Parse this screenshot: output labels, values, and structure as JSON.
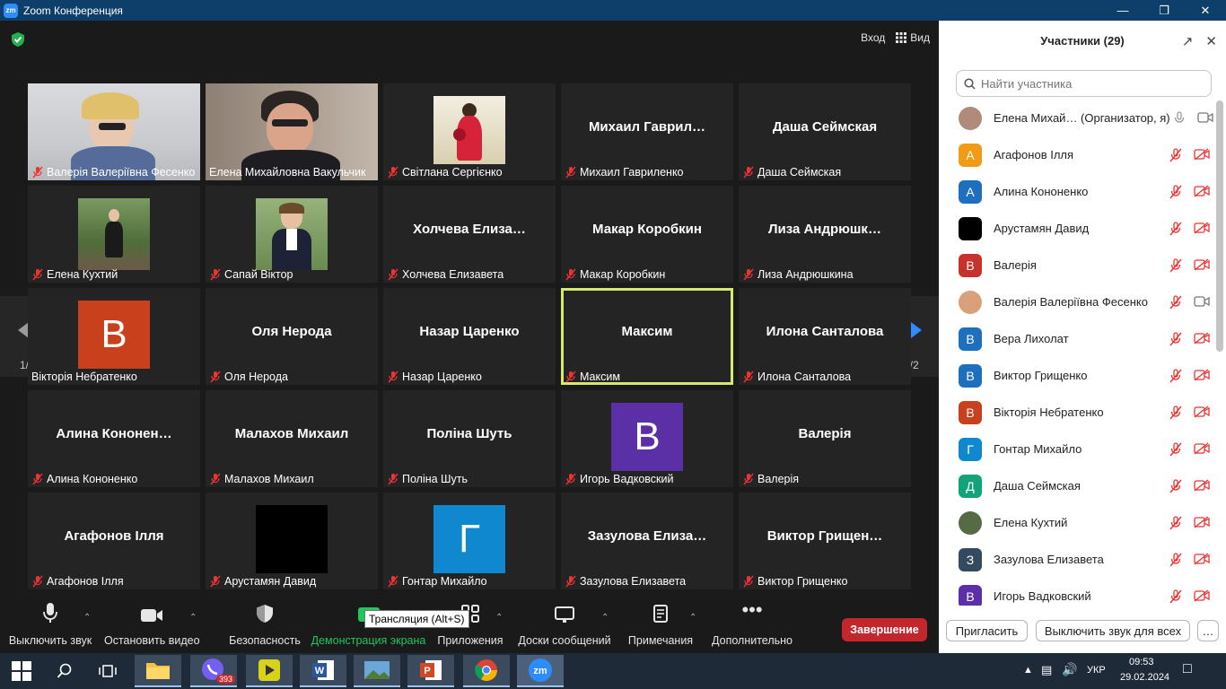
{
  "window": {
    "title": "Zoom Конференция",
    "logo_text": "zm"
  },
  "top": {
    "enter_label": "Вход",
    "view_label": "Вид"
  },
  "pager": {
    "left": "1/2",
    "right": "1/2"
  },
  "tiles": [
    {
      "label": "Валерія Валеріївна Фесенко",
      "kind": "photo1",
      "muted": true
    },
    {
      "label": "Елена Михайловна Вакульчик",
      "kind": "photo2",
      "muted": false
    },
    {
      "label": "Світлана Сергієнко",
      "kind": "photo3",
      "muted": true
    },
    {
      "label": "Михаил Гавриленко",
      "big": "Михаил  Гаврил…",
      "muted": true
    },
    {
      "label": "Даша Сеймская",
      "big": "Даша Сеймская",
      "muted": true
    },
    {
      "label": "Елена Кухтий",
      "kind": "photo4",
      "muted": true
    },
    {
      "label": "Сапай Віктор",
      "kind": "photo5",
      "muted": true
    },
    {
      "label": "Холчева Елизавета",
      "big": "Холчева  Елиза…",
      "muted": true
    },
    {
      "label": "Макар Коробкин",
      "big": "Макар Коробкин",
      "muted": true
    },
    {
      "label": "Лиза Андрюшкина",
      "big": "Лиза  Андрюшк…",
      "muted": true
    },
    {
      "label": "Вікторія Небратенко",
      "avatar": "В",
      "avatar_color": "#c8401c",
      "muted": false
    },
    {
      "label": "Оля Нерода",
      "big": "Оля Нерода",
      "muted": true
    },
    {
      "label": "Назар Царенко",
      "big": "Назар Царенко",
      "muted": true
    },
    {
      "label": "Максим",
      "big": "Максим",
      "muted": true,
      "active": true
    },
    {
      "label": "Илона Санталова",
      "big": "Илона Санталова",
      "muted": true
    },
    {
      "label": "Алина Кононенко",
      "big": "Алина  Кононен…",
      "muted": true
    },
    {
      "label": "Малахов Михаил",
      "big": "Малахов Михаил",
      "muted": true
    },
    {
      "label": "Поліна Шуть",
      "big": "Поліна Шуть",
      "muted": true
    },
    {
      "label": "Игорь Вадковский",
      "avatar": "В",
      "avatar_color": "#5b2fa6",
      "muted": true
    },
    {
      "label": "Валерія",
      "big": "Валерія",
      "muted": true
    },
    {
      "label": "Агафонов Ілля",
      "big": "Агафонов Ілля",
      "muted": true
    },
    {
      "label": "Арустамян Давид",
      "avatar": "",
      "avatar_color": "#000000",
      "muted": true
    },
    {
      "label": "Гонтар Михайло",
      "avatar": "Г",
      "avatar_color": "#1088d0",
      "muted": true
    },
    {
      "label": "Зазулова Елизавета",
      "big": "Зазулова  Елиза…",
      "muted": true
    },
    {
      "label": "Виктор Грищенко",
      "big": "Виктор  Грищен…",
      "muted": true
    }
  ],
  "toolbar": {
    "mute": "Выключить звук",
    "video": "Остановить видео",
    "security": "Безопасность",
    "share": "Демонстрация экрана",
    "apps": "Приложения",
    "whiteboard": "Доски сообщений",
    "notes": "Примечания",
    "more": "Дополнительно",
    "end": "Завершение",
    "tooltip": "Трансляция (Alt+S)"
  },
  "panel": {
    "title": "Участники (29)",
    "search_placeholder": "Найти участника",
    "invite": "Пригласить",
    "mute_all": "Выключить звук для всех",
    "more": "…",
    "participants": [
      {
        "name": "Елена Михай… (Организатор, я)",
        "initial": "",
        "color": "#b08a7a",
        "photo": true,
        "host": true
      },
      {
        "name": "Агафонов Ілля",
        "initial": "А",
        "color": "#f09a16"
      },
      {
        "name": "Алина Кононенко",
        "initial": "А",
        "color": "#1f6fbf"
      },
      {
        "name": "Арустамян Давид",
        "initial": "",
        "color": "#000000"
      },
      {
        "name": "Валерія",
        "initial": "В",
        "color": "#c8322c"
      },
      {
        "name": "Валерія Валеріївна Фесенко",
        "initial": "",
        "color": "#d9a07a",
        "photo": true,
        "video_on": true
      },
      {
        "name": "Вера Лихолат",
        "initial": "В",
        "color": "#1f6fbf"
      },
      {
        "name": "Виктор Грищенко",
        "initial": "В",
        "color": "#1f6fbf"
      },
      {
        "name": "Вікторія Небратенко",
        "initial": "В",
        "color": "#c8401c"
      },
      {
        "name": "Гонтар Михайло",
        "initial": "Г",
        "color": "#1088d0"
      },
      {
        "name": "Даша Сеймская",
        "initial": "Д",
        "color": "#12a37a"
      },
      {
        "name": "Елена Кухтий",
        "initial": "",
        "color": "#556b45",
        "photo": true
      },
      {
        "name": "Зазулова Елизавета",
        "initial": "З",
        "color": "#344a5e"
      },
      {
        "name": "Игорь Вадковский",
        "initial": "В",
        "color": "#5b2fa6"
      }
    ]
  },
  "taskbar": {
    "lang": "УКР",
    "time": "09:53",
    "date": "29.02.2024",
    "viber_badge": "393"
  }
}
